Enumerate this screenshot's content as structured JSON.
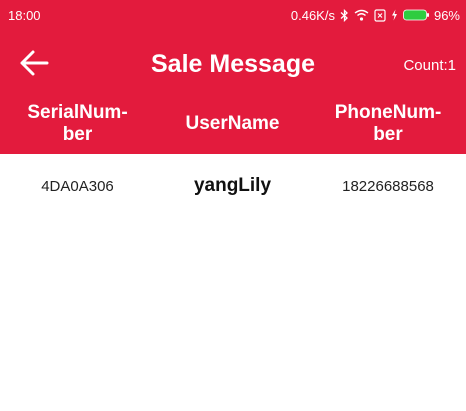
{
  "status_bar": {
    "time": "18:00",
    "net_speed": "0.46K/s",
    "battery_percent": "96%",
    "battery_level": 0.96,
    "icons": [
      "bluetooth-icon",
      "wifi-icon",
      "sim-icon",
      "charging-icon",
      "battery-icon"
    ]
  },
  "app_bar": {
    "back_icon": "arrow-left-icon",
    "title": "Sale Message",
    "count_label": "Count:1"
  },
  "table": {
    "headers": [
      {
        "line1": "SerialNum-",
        "line2": "ber"
      },
      {
        "line1": "UserName",
        "line2": ""
      },
      {
        "line1": "PhoneNum-",
        "line2": "ber"
      }
    ],
    "rows": [
      {
        "serial": "4DA0A306",
        "user": "yangLily",
        "phone": "18226688568"
      }
    ]
  },
  "colors": {
    "primary": "#e31b3d",
    "background": "#ffffff",
    "text": "#222222"
  }
}
